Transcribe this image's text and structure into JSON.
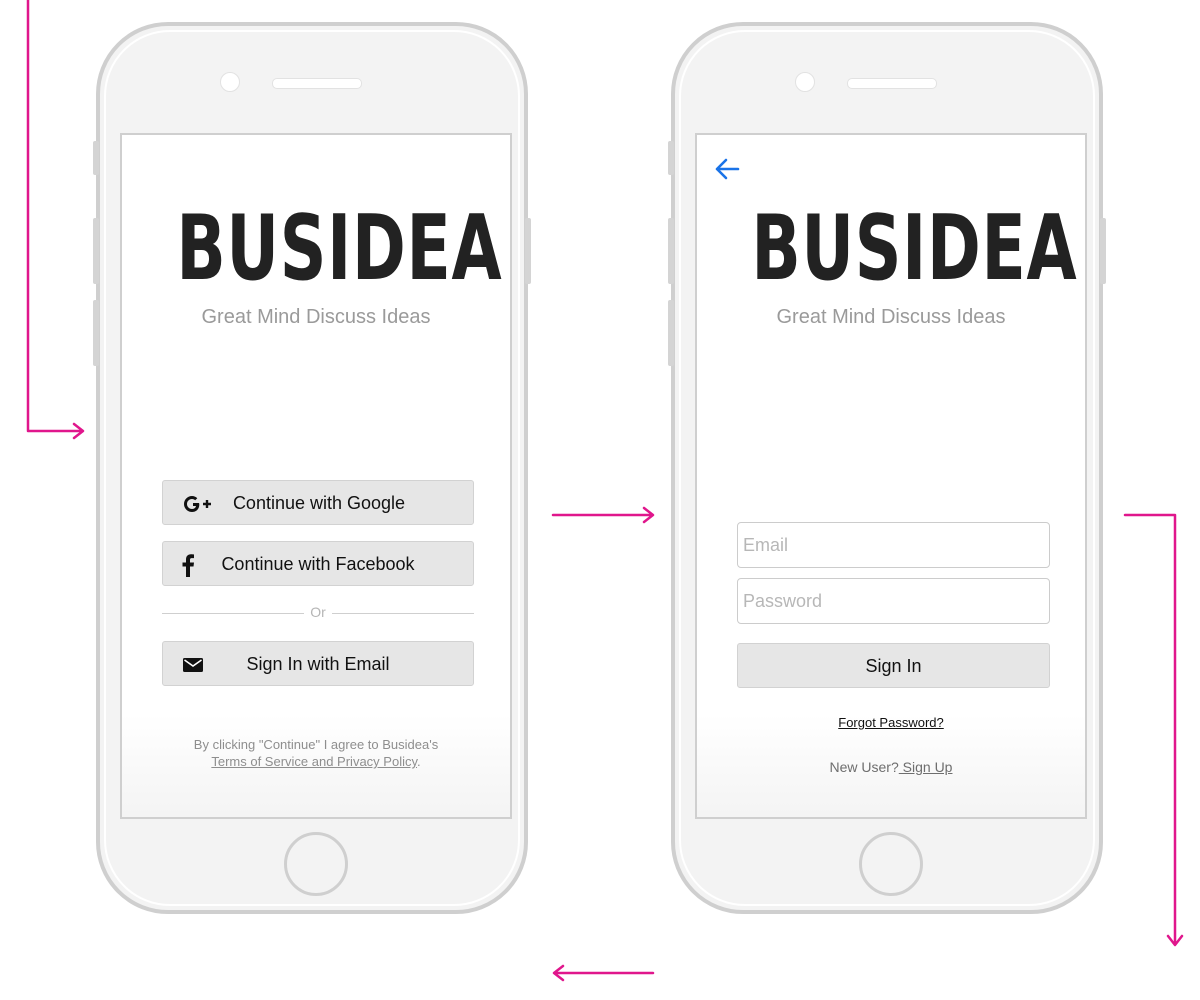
{
  "brand": {
    "logo_text": "BUSIDEA",
    "tagline": "Great Mind Discuss Ideas"
  },
  "welcome_screen": {
    "google_button": "Continue with Google",
    "facebook_button": "Continue with Facebook",
    "divider_text": "Or",
    "email_button": "Sign In with Email",
    "terms_prefix": "By clicking \"Continue\" I agree to Busidea's",
    "terms_link": "Terms of Service and Privacy Policy",
    "terms_suffix": "."
  },
  "signin_screen": {
    "email_placeholder": "Email",
    "password_placeholder": "Password",
    "signin_button": "Sign In",
    "forgot_password": "Forgot Password?",
    "new_user_prefix": "New User?",
    "signup_link": " Sign Up"
  },
  "icons": {
    "back": "arrow-left-icon",
    "google": "google-plus-icon",
    "facebook": "facebook-icon",
    "email": "envelope-icon"
  },
  "colors": {
    "flow_arrow": "#e0168c",
    "back_arrow": "#1a73e8",
    "button_bg": "#e6e6e6",
    "tagline": "#9a9a9a"
  }
}
